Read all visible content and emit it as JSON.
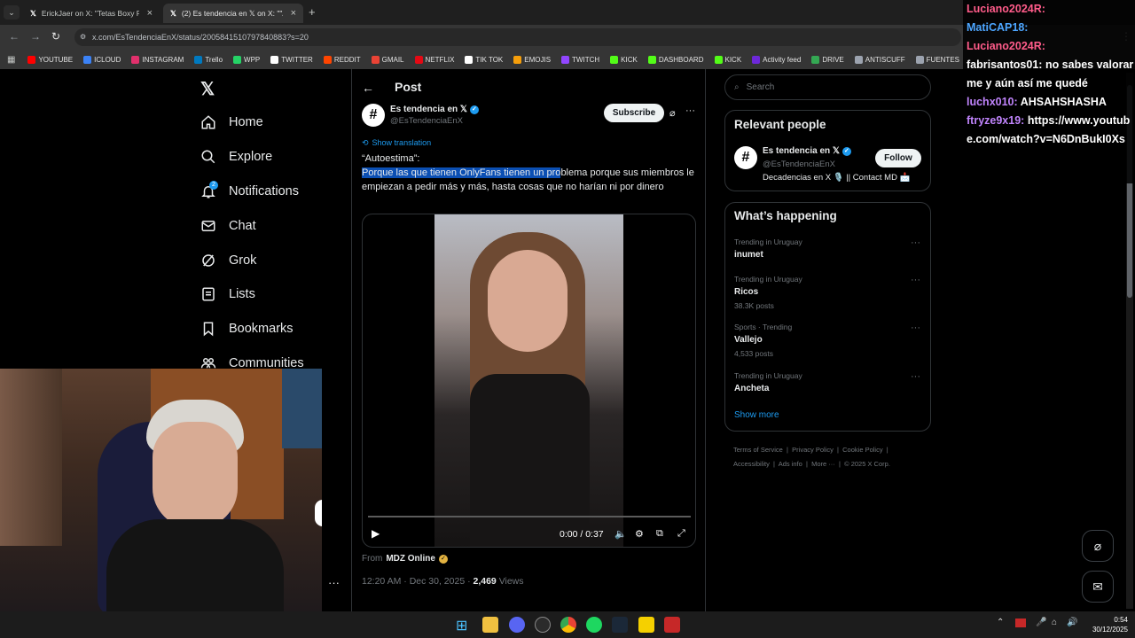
{
  "browser": {
    "tabs": [
      {
        "label": "ErickJaer on X: \"Tetas Boxy Fit I...",
        "active": false
      },
      {
        "label": "(2) Es tendencia en 𝕏 on X: \"\"Au...",
        "active": true
      }
    ],
    "new_tab": "+",
    "url": "x.com/EsTendenciaEnX/status/2005841510797840883?s=20",
    "bookmarks": [
      {
        "label": "YOUTUBE",
        "color": "#ff0000"
      },
      {
        "label": "ICLOUD",
        "color": "#3b82f6"
      },
      {
        "label": "INSTAGRAM",
        "color": "#e1306c"
      },
      {
        "label": "Trello",
        "color": "#0079bf"
      },
      {
        "label": "WPP",
        "color": "#25d366"
      },
      {
        "label": "TWITTER",
        "color": "#ffffff"
      },
      {
        "label": "REDDIT",
        "color": "#ff4500"
      },
      {
        "label": "GMAIL",
        "color": "#ea4335"
      },
      {
        "label": "NETFLIX",
        "color": "#e50914"
      },
      {
        "label": "TIK TOK",
        "color": "#ffffff"
      },
      {
        "label": "EMOJIS",
        "color": "#f59e0b"
      },
      {
        "label": "TWITCH",
        "color": "#9146ff"
      },
      {
        "label": "KICK",
        "color": "#53fc18"
      },
      {
        "label": "DASHBOARD",
        "color": "#53fc18"
      },
      {
        "label": "KICK",
        "color": "#53fc18"
      },
      {
        "label": "Activity feed",
        "color": "#6d28d9"
      },
      {
        "label": "DRIVE",
        "color": "#34a853"
      },
      {
        "label": "ANTISCUFF",
        "color": "#9ca3af"
      },
      {
        "label": "FUENTES",
        "color": "#9ca3af"
      }
    ]
  },
  "nav": {
    "items": [
      {
        "label": "Home",
        "icon": "home-icon"
      },
      {
        "label": "Explore",
        "icon": "search-icon"
      },
      {
        "label": "Notifications",
        "icon": "bell-icon",
        "badge": "2"
      },
      {
        "label": "Chat",
        "icon": "mail-icon"
      },
      {
        "label": "Grok",
        "icon": "grok-icon"
      },
      {
        "label": "Lists",
        "icon": "list-icon"
      },
      {
        "label": "Bookmarks",
        "icon": "bookmark-icon"
      },
      {
        "label": "Communities",
        "icon": "communities-icon"
      }
    ],
    "more": "···"
  },
  "post": {
    "header": "Post",
    "author_name": "Es tendencia en 𝕏",
    "author_handle": "@EsTendenciaEnX",
    "subscribe": "Subscribe",
    "translate": "Show translation",
    "title_line": "“Autoestima”:",
    "body_highlight": "Porque las que tienen OnlyFans tienen un pro",
    "body_rest": "blema porque sus miembros le empiezan a pedir más y más, hasta cosas que no harían ni por dinero",
    "video": {
      "time": "0:00 / 0:37",
      "progress": 0.0
    },
    "from_label": "From",
    "from_name": "MDZ Online",
    "timestamp": "12:20 AM · Dec 30, 2025 · ",
    "views_count": "2,469",
    "views_label": " Views"
  },
  "sidebar": {
    "search_placeholder": "Search",
    "relevant_title": "Relevant people",
    "person": {
      "name": "Es tendencia en 𝕏",
      "handle": "@EsTendenciaEnX",
      "bio": "Decadencias en X 🎙️ || Contact MD 📩",
      "follow": "Follow"
    },
    "happening_title": "What’s happening",
    "trends": [
      {
        "category": "Trending in Uruguay",
        "name": "inumet",
        "posts": ""
      },
      {
        "category": "Trending in Uruguay",
        "name": "Ricos",
        "posts": "38.3K posts"
      },
      {
        "category": "Sports · Trending",
        "name": "Vallejo",
        "posts": "4,533 posts"
      },
      {
        "category": "Trending in Uruguay",
        "name": "Ancheta",
        "posts": ""
      }
    ],
    "show_more": "Show more",
    "footer": [
      "Terms of Service",
      "Privacy Policy",
      "Cookie Policy",
      "Accessibility",
      "Ads info",
      "More ···",
      "© 2025 X Corp."
    ]
  },
  "chat": {
    "lines": [
      {
        "user": "Luciano2024R:",
        "text": "",
        "color": "#ff5c8a"
      },
      {
        "user": "MatiCAP18:",
        "text": "",
        "color": "#4da6ff"
      },
      {
        "user": "Luciano2024R:",
        "text": "",
        "color": "#ff5c8a"
      },
      {
        "user": "fabrisantos01:",
        "text": "no sabes valorarme y aún así me quedé",
        "color": "#ffffff"
      },
      {
        "user": "luchx010:",
        "text": "AHSAHSHASHA",
        "color": "#c084fc"
      },
      {
        "user": "ftryze9x19:",
        "text": "https://www.youtube.com/watch?v=N6DnBukI0Xs",
        "color": "#c084fc"
      }
    ]
  },
  "taskbar": {
    "time": "0:54",
    "date": "30/12/2025"
  }
}
